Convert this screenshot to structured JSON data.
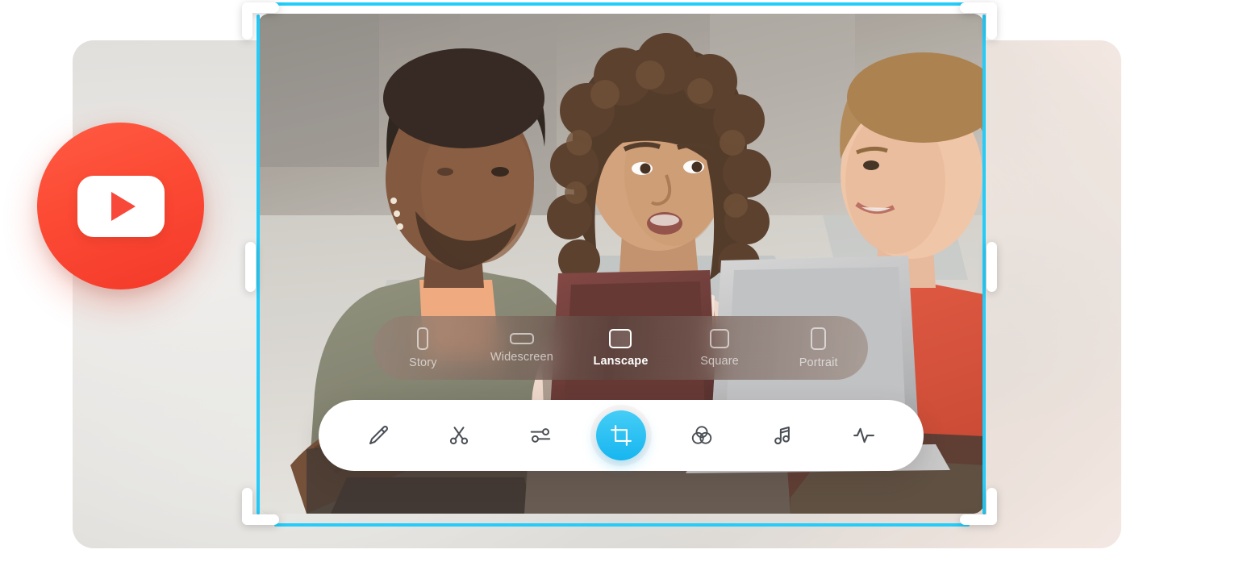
{
  "app": {
    "title": "Video Editor — Crop",
    "accent_color": "#17b6f0",
    "crop_guide_color": "#24ccfa",
    "brand_badge_color": "#f8483a"
  },
  "brand_badge": {
    "name": "youtube-logo",
    "label": "YouTube"
  },
  "preview": {
    "name": "video-preview",
    "alt": "Three young people sitting outdoors at a table talking, with a laptop and a notebook"
  },
  "crop_handles": {
    "corners": [
      {
        "name": "crop-handle-top-left",
        "label": "Top left"
      },
      {
        "name": "crop-handle-top-right",
        "label": "Top right"
      },
      {
        "name": "crop-handle-bottom-left",
        "label": "Bottom left"
      },
      {
        "name": "crop-handle-bottom-right",
        "label": "Bottom right"
      }
    ],
    "sides": [
      {
        "name": "crop-handle-left",
        "label": "Left"
      },
      {
        "name": "crop-handle-right",
        "label": "Right"
      }
    ]
  },
  "ratio_bar": {
    "selected": "Lanscape",
    "items": [
      {
        "label": "Story",
        "glyph": "story-ratio-icon",
        "active": false
      },
      {
        "label": "Widescreen",
        "glyph": "widescreen-ratio-icon",
        "active": false
      },
      {
        "label": "Lanscape",
        "glyph": "landscape-ratio-icon",
        "active": true
      },
      {
        "label": "Square",
        "glyph": "square-ratio-icon",
        "active": false
      },
      {
        "label": "Portrait",
        "glyph": "portrait-ratio-icon",
        "active": false
      }
    ]
  },
  "toolbar": {
    "active_tool": "Crop",
    "items": [
      {
        "name": "pencil-icon",
        "label": "Draw",
        "active": false
      },
      {
        "name": "scissors-icon",
        "label": "Trim",
        "active": false
      },
      {
        "name": "sliders-icon",
        "label": "Adjust",
        "active": false
      },
      {
        "name": "crop-icon",
        "label": "Crop",
        "active": true
      },
      {
        "name": "filters-icon",
        "label": "Filters",
        "active": false
      },
      {
        "name": "music-note-icon",
        "label": "Audio",
        "active": false
      },
      {
        "name": "waveform-icon",
        "label": "Effects",
        "active": false
      }
    ]
  }
}
